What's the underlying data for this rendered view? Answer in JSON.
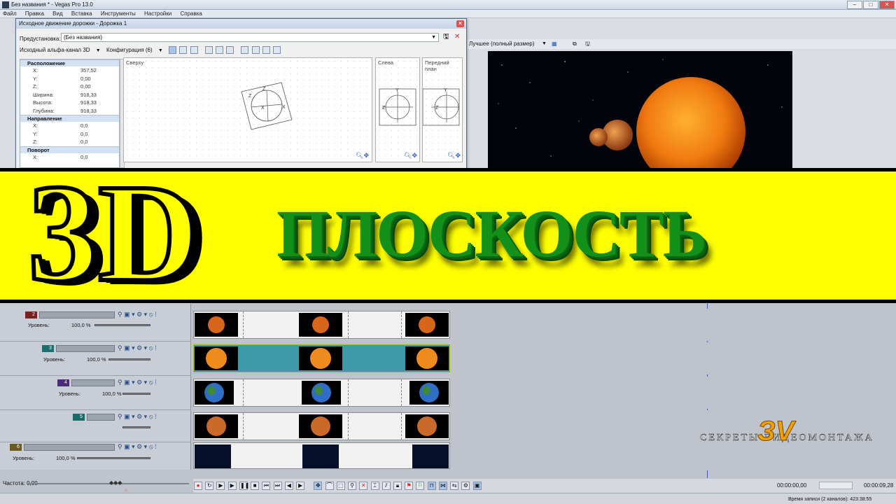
{
  "app": {
    "title": "Без названия * - Vegas Pro 13.0",
    "menu": [
      "Файл",
      "Правка",
      "Вид",
      "Вставка",
      "Инструменты",
      "Настройки",
      "Справка"
    ]
  },
  "dialog": {
    "title": "Исходное движение дорожки - Дорожка 1",
    "preset_label": "Предустановка:",
    "preset_value": "(Без названия)",
    "alpha_label": "Исходный альфа-канал 3D",
    "config_label": "Конфигурация (6)",
    "sections": [
      {
        "name": "Расположение",
        "rows": [
          [
            "X:",
            "357,52"
          ],
          [
            "Y:",
            "0,00"
          ],
          [
            "Z:",
            "0,00"
          ],
          [
            "Ширина:",
            "918,33"
          ],
          [
            "Высота:",
            "918,33"
          ],
          [
            "Глубина:",
            "918,33"
          ]
        ]
      },
      {
        "name": "Направление",
        "rows": [
          [
            "X:",
            "0,0"
          ],
          [
            "Y:",
            "0,0"
          ],
          [
            "Z:",
            "0,0"
          ]
        ]
      },
      {
        "name": "Поворот",
        "rows": [
          [
            "X:",
            "0,0"
          ]
        ]
      }
    ],
    "views": {
      "top": "Сверху",
      "left": "Слева",
      "front": "Передний план"
    }
  },
  "preview": {
    "quality": "Лучшее (полный размер)"
  },
  "banner": {
    "left_text": "3D",
    "right_text": "ПЛОСКОСТЬ"
  },
  "tracks": [
    {
      "num": "2",
      "level_label": "Уровень:",
      "level": "100,0 %",
      "color": "#7a2020"
    },
    {
      "num": "3",
      "level_label": "Уровень:",
      "level": "100,0 %",
      "color": "#1f6e6e"
    },
    {
      "num": "4",
      "level_label": "Уровень:",
      "level": "100,0 %",
      "color": "#4b2b7a"
    },
    {
      "num": "5",
      "level_label": "",
      "level": "",
      "color": "#1c6a6a"
    },
    {
      "num": "6",
      "level_label": "Уровень:",
      "level": "100,0 %",
      "color": "#6a5a20"
    }
  ],
  "watermark": {
    "text": "СЕКРЕТЫ ВИДЕОМОНТАЖА",
    "logo": "ЗV"
  },
  "status": {
    "rate": "Частота: 0,00",
    "time1": "00:00:00,00",
    "time2": "00:00:09,28",
    "record": "Время записи (2 каналов): 423:38:55"
  },
  "colors": {
    "banner_bg": "#ffff00",
    "plane_text": "#138a13",
    "selected_lane": "#3f9aa7"
  }
}
